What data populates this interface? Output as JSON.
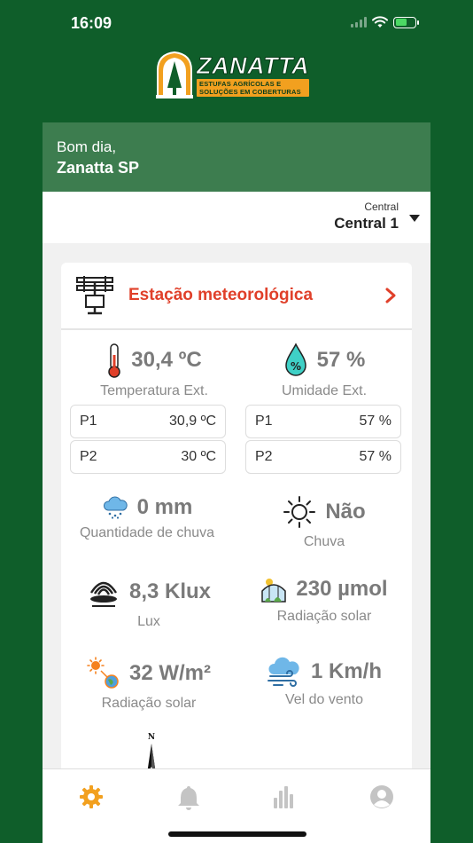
{
  "status_bar": {
    "time": "16:09"
  },
  "logo": {
    "title": "ZANATTA",
    "subtitle_line1": "ESTUFAS AGRÍCOLAS E",
    "subtitle_line2": "SOLUÇÕES EM COBERTURAS"
  },
  "greeting": {
    "salutation": "Bom dia,",
    "user": "Zanatta SP"
  },
  "central": {
    "caption": "Central",
    "selected": "Central 1"
  },
  "station": {
    "title": "Estação meteorológica",
    "temperature": {
      "value": "30,4 ºC",
      "label": "Temperatura Ext."
    },
    "humidity": {
      "value": "57 %",
      "label": "Umidade Ext."
    },
    "temp_sensors": [
      {
        "name": "P1",
        "value": "30,9 ºC"
      },
      {
        "name": "P2",
        "value": "30 ºC"
      }
    ],
    "humidity_sensors": [
      {
        "name": "P1",
        "value": "57 %"
      },
      {
        "name": "P2",
        "value": "57 %"
      }
    ],
    "rain_amount": {
      "value": "0 mm",
      "label": "Quantidade de chuva"
    },
    "rain": {
      "value": "Não",
      "label": "Chuva"
    },
    "lux": {
      "value": "8,3 Klux",
      "label": "Lux"
    },
    "par": {
      "value": "230 µmol",
      "label": "Radiação solar"
    },
    "irradiance": {
      "value": "32 W/m²",
      "label": "Radiação solar"
    },
    "wind": {
      "value": "1 Km/h",
      "label": "Vel do vento"
    },
    "compass_north": "N"
  },
  "nav": {
    "items": [
      {
        "icon": "gear-icon"
      },
      {
        "icon": "bell-icon"
      },
      {
        "icon": "bar-chart-icon"
      },
      {
        "icon": "user-icon"
      }
    ],
    "active_color": "#f2a01f",
    "inactive_color": "#c4c4c4"
  },
  "colors": {
    "brand_green": "#0f5e2a",
    "header_green": "#3d7d4f",
    "accent_red": "#e0402a"
  }
}
